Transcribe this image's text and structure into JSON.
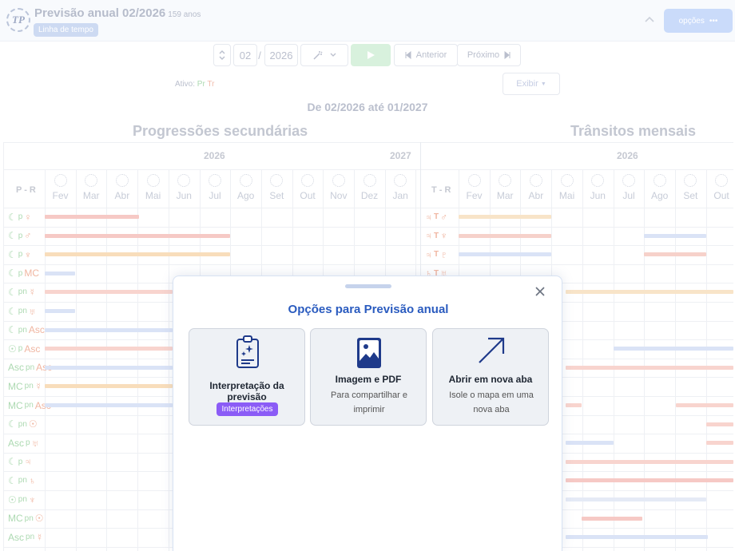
{
  "header": {
    "logo_text": "TP",
    "title": "Previsão anual 02/2026",
    "age": "159 anos",
    "timeline_badge": "Linha de tempo",
    "options_label": "opções",
    "options_dots": "•••"
  },
  "controls": {
    "month": "02",
    "separator": "/",
    "year": "2026",
    "prev_label": "Anterior",
    "next_label": "Próximo",
    "active_label": "Ativo:",
    "active_pr": "Pr",
    "active_tr": "Tr",
    "show_label": "Exibir"
  },
  "range_text": "De 02/2026 até 01/2027",
  "sections": {
    "progressions_title": "Progressões secundárias",
    "transits_title": "Trânsitos mensais"
  },
  "grid": {
    "years_left": [
      "2026",
      "2027"
    ],
    "year_right": "2026",
    "pr_label": "P - R",
    "tr_label": "T - R",
    "months_left": [
      "Fev",
      "Mar",
      "Abr",
      "Mai",
      "Jun",
      "Jul",
      "Ago",
      "Set",
      "Out",
      "Nov",
      "Dez",
      "Jan"
    ],
    "months_right": [
      "Fev",
      "Mar",
      "Abr",
      "Mai",
      "Jun",
      "Jul",
      "Ago",
      "Set",
      "Out"
    ],
    "rows_left": [
      {
        "a": "☾",
        "s": "p",
        "b": "♀"
      },
      {
        "a": "☾",
        "s": "p",
        "b": "♂"
      },
      {
        "a": "☾",
        "s": "p",
        "b": "♆"
      },
      {
        "a": "☾",
        "s": "p",
        "b": "MC"
      },
      {
        "a": "☾",
        "s": "pn",
        "b": "☿"
      },
      {
        "a": "☾",
        "s": "pn",
        "b": "♅"
      },
      {
        "a": "☾",
        "s": "pn",
        "b": "Asc"
      },
      {
        "a": "☉",
        "s": "p",
        "b": "Asc"
      },
      {
        "a": "Asc",
        "s": "pn",
        "b": "Asc"
      },
      {
        "a": "MC",
        "s": "pn",
        "b": "☿"
      },
      {
        "a": "MC",
        "s": "pn",
        "b": "Asc"
      },
      {
        "a": "☾",
        "s": "pn",
        "b": "☉"
      },
      {
        "a": "Asc",
        "s": "p",
        "b": "♅"
      },
      {
        "a": "☾",
        "s": "p",
        "b": "♃"
      },
      {
        "a": "☾",
        "s": "pn",
        "b": "♄"
      },
      {
        "a": "☉",
        "s": "pn",
        "b": "♆"
      },
      {
        "a": "MC",
        "s": "pn",
        "b": "☉"
      },
      {
        "a": "Asc",
        "s": "pn",
        "b": "☿"
      }
    ],
    "rows_right": [
      {
        "a": "♃",
        "s": "T",
        "b": "♂"
      },
      {
        "a": "♃",
        "s": "T",
        "b": "♆"
      },
      {
        "a": "♃",
        "s": "T",
        "b": "♇"
      },
      {
        "a": "♄",
        "s": "T",
        "b": "♅"
      }
    ]
  },
  "modal": {
    "title": "Opções para Previsão anual",
    "cards": [
      {
        "title": "Interpretação da previsão",
        "badge": "Interpretações"
      },
      {
        "title": "Imagem e PDF",
        "subtitle": "Para compartilhar e imprimir"
      },
      {
        "title": "Abrir em nova aba",
        "subtitle": "Isole o mapa em uma nova aba"
      }
    ]
  },
  "colors": {
    "accent_blue": "#2a5bbf",
    "badge_purple": "#8b5cf6",
    "progression_green": "#a9d8ae",
    "transit_orange": "#f0b39d"
  }
}
